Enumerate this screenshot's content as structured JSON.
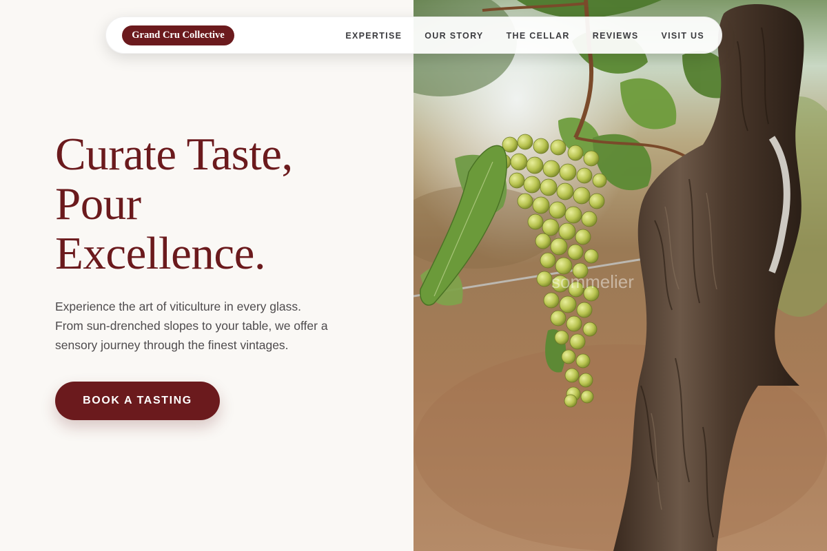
{
  "brand": {
    "name": "Grand Cru Collective"
  },
  "nav": {
    "links": [
      {
        "label": "EXPERTISE"
      },
      {
        "label": "OUR STORY"
      },
      {
        "label": "THE CELLAR"
      },
      {
        "label": "REVIEWS"
      },
      {
        "label": "VISIT US"
      }
    ]
  },
  "hero": {
    "title_lines": [
      "Curate Taste,",
      "Pour",
      "Excellence."
    ],
    "subtitle_lines": [
      "Experience the art of viticulture in every glass.",
      "From sun-drenched slopes to your table, we offer a",
      "sensory journey through the finest vintages."
    ],
    "cta_label": "BOOK A TASTING"
  },
  "image": {
    "subject": "vineyard-grape-cluster-photo",
    "watermark": "sommelier"
  },
  "colors": {
    "brand": "#6b1a1d",
    "page_background": "#faf8f5",
    "body_text": "#4e4b4d",
    "nav_text": "#3b3b3f"
  }
}
